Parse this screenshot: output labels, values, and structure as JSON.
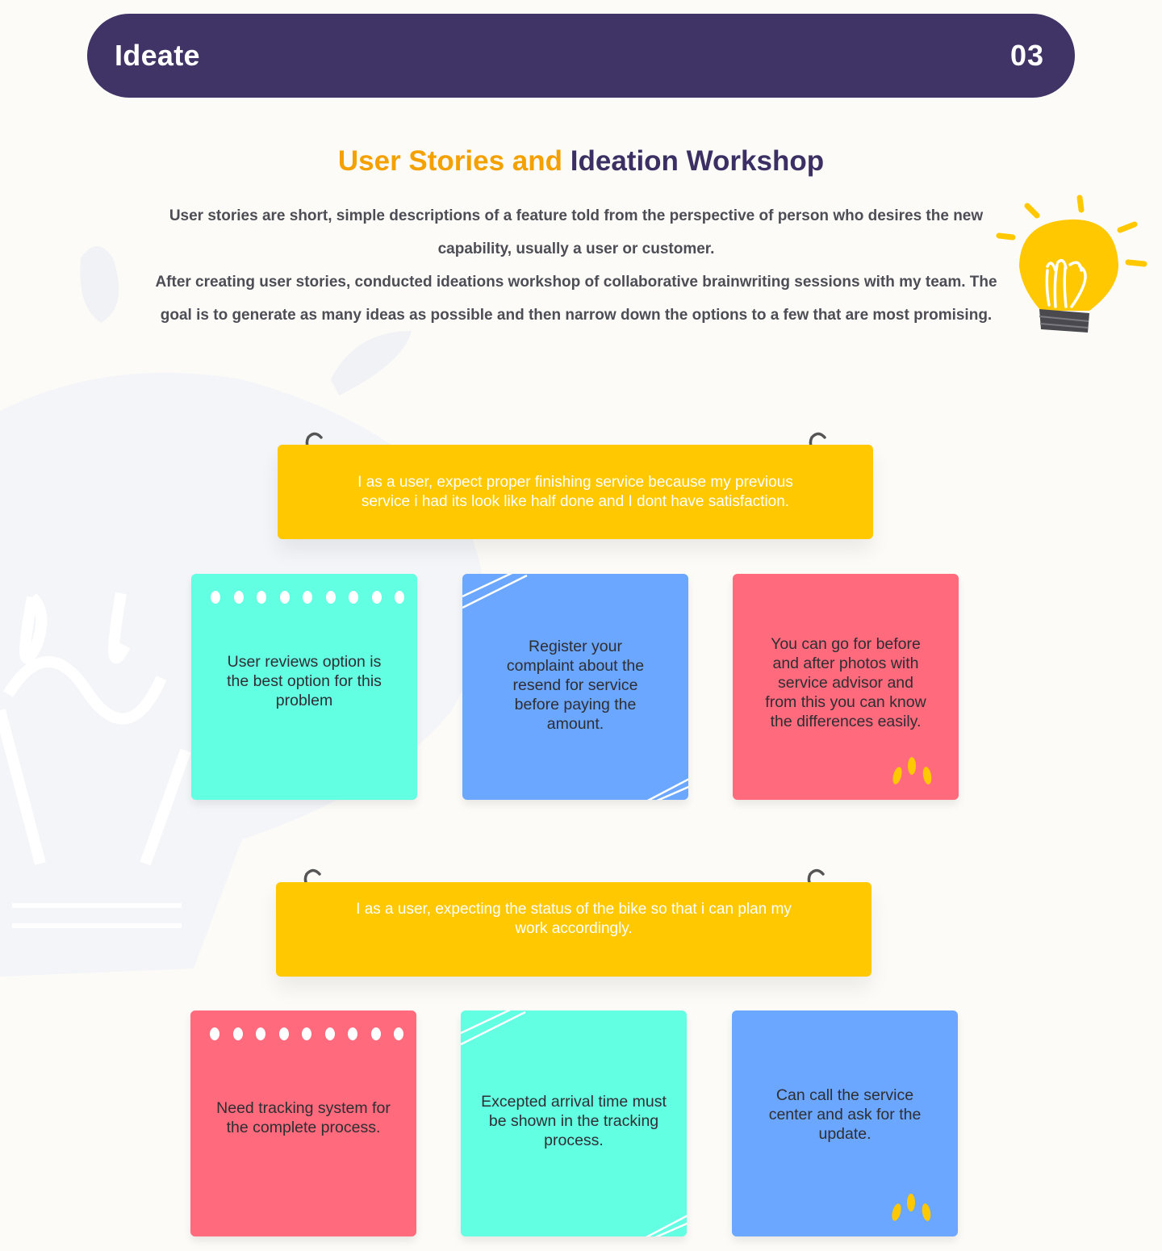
{
  "header": {
    "title": "Ideate",
    "number": "03"
  },
  "heading": {
    "part1": "User Stories and",
    "part2": "Ideation Workshop"
  },
  "intro": {
    "line1": "User stories are short, simple descriptions of a feature told from the perspective of person who desires the new capability, usually a user or customer.",
    "line2": "After creating user stories, conducted ideations workshop of collaborative brainwriting sessions with my team. The goal is to generate as many ideas as possible and then narrow down the options to a few that are most promising."
  },
  "stories": [
    {
      "text": "I as a user, expect proper finishing service because my previous service i had its look like half done and I dont have satisfaction.",
      "ideas": [
        {
          "text": "User reviews option is the best option for this problem",
          "color": "#63ffe3"
        },
        {
          "text": "Register your complaint about the resend for service before paying the amount.",
          "color": "#6ba6ff"
        },
        {
          "text": "You can go for before and after photos with service advisor and from this you can know the differences easily.",
          "color": "#ff6a7c"
        }
      ]
    },
    {
      "text": "I as a user, expecting the status of the bike so that i can plan my work accordingly.",
      "ideas": [
        {
          "text": "Need tracking system for the complete process.",
          "color": "#ff6a7c"
        },
        {
          "text": "Excepted arrival time must be shown in the tracking process.",
          "color": "#63ffe3"
        },
        {
          "text": "Can call the service center and ask for the update.",
          "color": "#6ba6ff"
        }
      ]
    }
  ],
  "colors": {
    "header": "#403366",
    "accent_orange": "#f4a100",
    "accent_purple": "#3b2f63",
    "story": "#ffc800"
  },
  "icons": [
    "lightbulb-icon",
    "binder-ring-icon",
    "sparkle-icon"
  ]
}
